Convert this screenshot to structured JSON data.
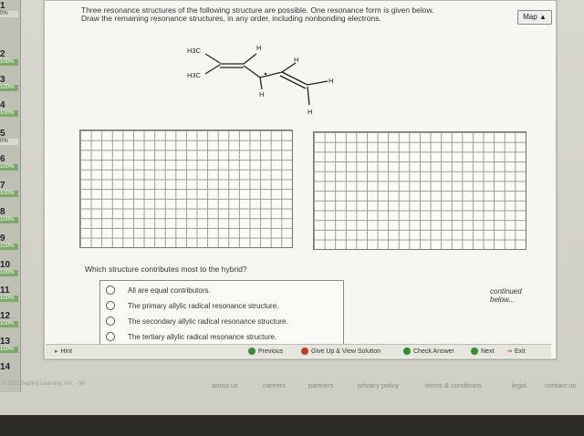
{
  "prompt": {
    "line1": "Three resonance structures of the following structure are possible. One resonance form is given below.",
    "line2": "Draw the remaining resonance structures, in any order, including nonbonding electrons."
  },
  "map_button": "Map",
  "molecule_labels": {
    "h3c_top": "H3C",
    "h3c_bottom": "H3C",
    "h": "H"
  },
  "sidebar": [
    {
      "num": "1",
      "pct": "0%"
    },
    {
      "num": "2",
      "pct": "100%"
    },
    {
      "num": "3",
      "pct": "100%"
    },
    {
      "num": "4",
      "pct": "100%"
    },
    {
      "num": "5",
      "pct": "0%"
    },
    {
      "num": "6",
      "pct": "100%"
    },
    {
      "num": "7",
      "pct": "100%"
    },
    {
      "num": "8",
      "pct": "100%"
    },
    {
      "num": "9",
      "pct": "100%"
    },
    {
      "num": "10",
      "pct": "100%"
    },
    {
      "num": "11",
      "pct": "100%"
    },
    {
      "num": "12",
      "pct": "100%"
    },
    {
      "num": "13",
      "pct": "100%"
    },
    {
      "num": "14",
      "pct": ""
    }
  ],
  "question": "Which structure contributes most to the hybrid?",
  "choices": [
    "All are equal contributors.",
    "The primary allylic radical resonance structure.",
    "The secondary allylic radical resonance structure.",
    "The tertiary allylic radical resonance structure."
  ],
  "continued": "continued below...",
  "bottombar": {
    "hint": "Hint",
    "previous": "Previous",
    "give_up": "Give Up & View Solution",
    "check": "Check Answer",
    "next": "Next",
    "exit": "Exit"
  },
  "footer": {
    "copyright": "© 2011 Sapling Learning, Inc. - 68",
    "links": [
      "about us",
      "careers",
      "partners",
      "privacy policy",
      "terms & conditions",
      "legal",
      "contact us"
    ]
  },
  "colors": {
    "complete": "#7fa86a",
    "previous_btn": "#3a8a3a",
    "give_up": "#c0392b",
    "check": "#2e8b2e",
    "exit": "#c0392b"
  }
}
